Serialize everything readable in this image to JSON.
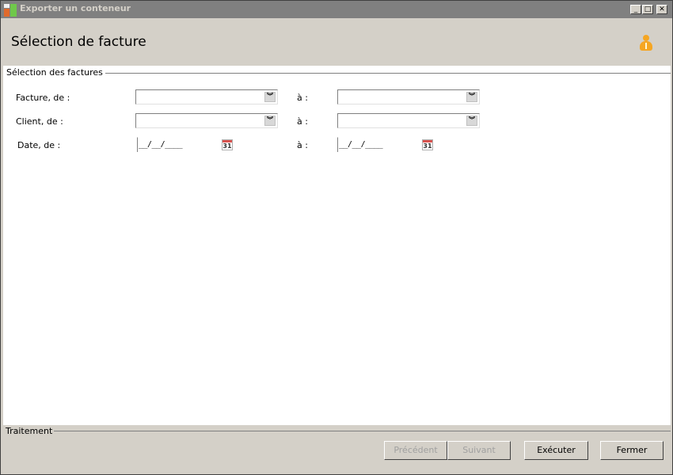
{
  "window": {
    "title": "Exporter un conteneur",
    "controls": {
      "minimize": "_",
      "maximize": "□",
      "close": "✕"
    }
  },
  "header": {
    "title": "Sélection de facture",
    "icon": "user-icon"
  },
  "selection": {
    "group_title": "Sélection des factures",
    "rows": [
      {
        "label": "Facture, de :",
        "to_label": "à :",
        "from_value": "",
        "to_value": ""
      },
      {
        "label": "Client, de  :",
        "to_label": "à :",
        "from_value": "",
        "to_value": ""
      },
      {
        "label": "Date, de  :",
        "to_label": "à :",
        "from_mask": "__/__/____",
        "to_mask": "__/__/____",
        "calendar_day": "31"
      }
    ]
  },
  "footer": {
    "group_title": "Traitement",
    "buttons": {
      "previous": "Précédent",
      "next": "Suivant",
      "execute": "Exécuter",
      "close": "Fermer"
    }
  },
  "colors": {
    "titlebar": "#808080",
    "window_bg": "#d4d0c8",
    "content_bg": "#ffffff",
    "user_icon": "#f5a623"
  }
}
